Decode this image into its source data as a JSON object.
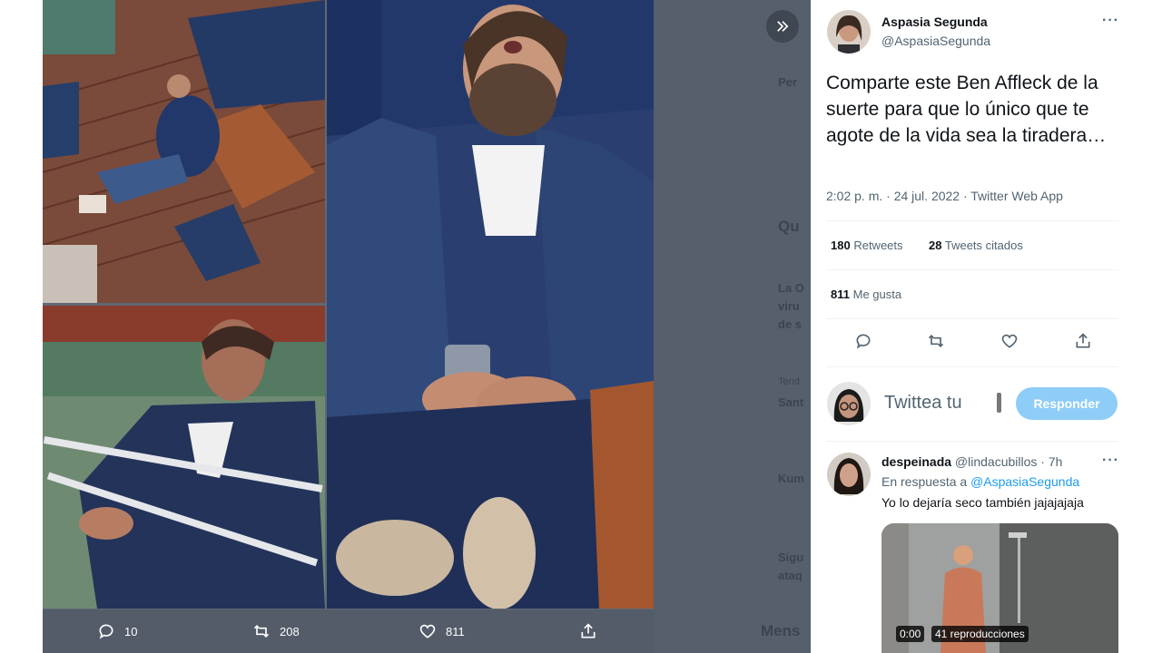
{
  "backdrop": {
    "bg_texts": [
      "Per",
      "Qu",
      "La O",
      "viru",
      "de s",
      "Tend",
      "Sant",
      "Kum",
      "Sigu",
      "ataq",
      "Mens"
    ]
  },
  "media_actions": {
    "reply_count": "10",
    "retweet_count": "208",
    "like_count": "811"
  },
  "tweet": {
    "author_name": "Aspasia Segunda",
    "author_handle": "@AspasiaSegunda",
    "text": "Comparte este Ben Affleck de la suerte para que lo único que te agote de la vida sea la tiradera…",
    "timestamp": "2:02 p. m. · 24 jul. 2022 · Twitter Web App",
    "retweets_count": "180",
    "retweets_label": "Retweets",
    "quotes_count": "28",
    "quotes_label": "Tweets citados",
    "likes_count": "811",
    "likes_label": "Me gusta"
  },
  "composer": {
    "placeholder": "Twittea tu",
    "reply_button": "Responder"
  },
  "reply": {
    "name": "despeinada",
    "handle": "@lindacubillos",
    "time": "· 7h",
    "in_reply_prefix": "En respuesta a",
    "in_reply_handle": "@AspasiaSegunda",
    "text": "Yo lo dejaría seco también jajajajaja",
    "video_time": "0:00",
    "video_views": "41 reproducciones"
  },
  "colors": {
    "accent": "#1d9bf0",
    "reply_button": "#8ecdf8",
    "backdrop": "#5f6876"
  }
}
